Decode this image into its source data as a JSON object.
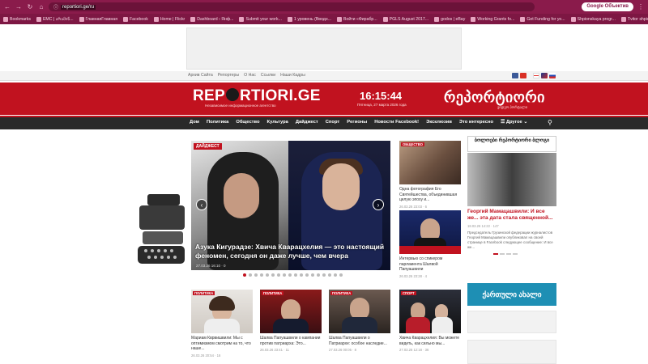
{
  "browser": {
    "url": "reportiori.ge/ru",
    "google_button": "Google Объектив",
    "bookmarks": [
      "Bookmarks",
      "EMC | არამიწ...",
      "ГлавнаяГлавная",
      "Facebook",
      "",
      "Home | Flickr",
      "Dashboard ‹ Янф...",
      "Submit your work...",
      "1 уровень (Вводн...",
      "Войти «Фирабр...",
      "PGLS August 2017...",
      "godos | eBay",
      "Working Grants fo...",
      "Get Funding for yo...",
      "Shpionskaya progr...",
      "Tvitor shpion"
    ]
  },
  "util": {
    "links": [
      "Архив Сайта",
      "Репортеры",
      "О Нас",
      "Ссылки",
      "Наши Кадры"
    ]
  },
  "header": {
    "logo_left": "REP",
    "logo_right": "RTIORI.GE",
    "logo_sub": "Независимое информационное агентство",
    "time": "16:15:44",
    "date": "Пятница, 27 марта 2026 года",
    "geo_title": "რეპორტიორი",
    "geo_sub": "ვიდეო პორტალი"
  },
  "menu": [
    "Дом",
    "Политика",
    "Общество",
    "Культура",
    "Дайджест",
    "Спорт",
    "Регионы",
    "Новости Facebook!",
    "Эксклюзив",
    "Это интересно",
    "☰ Другое ⌄"
  ],
  "slider": {
    "badge": "ДАЙДЖЕСТ",
    "title": "Азука Кигурадзе: Хвича Кварацхелия — это настоящий феномен, сегодня он даже лучше, чем вчера",
    "meta": "27.03.26 16:10 · 0",
    "active_index": 0,
    "dot_count": 18
  },
  "side_cards": [
    {
      "badge": "ОБЩЕСТВО",
      "text": "Одна фотография Его Святейшества, объединившая целую эпоху и...",
      "meta": "26.03.26 23:03 · 6"
    },
    {
      "badge": "",
      "text": "Интервью со спикером парламента Шалвой Папуашвили",
      "meta": "26.03.26 23:28 · 4"
    }
  ],
  "right_col": {
    "banner": "ბოლოები რეპორტიორი ბლოგი",
    "headline": "Георгий Мамацашвили: И все же... эта дата стала священной...",
    "meta": "18.03.26 14:22 · 147",
    "text": "Председатель Грузинской федерации журналистов Георгий Мамацашвили опубликовал на своей странице в Facebook следующее сообщение: И все же...",
    "geo_banner": "ქართული ახალი"
  },
  "bottom_cards": [
    {
      "badge": "ПОЛИТИКА",
      "text": "Мариам Кврвишвили: Мы с оптимизмом смотрим на то, что наше...",
      "meta": "26.03.26 20:54 · 16"
    },
    {
      "badge": "ПОЛИТИКА",
      "text": "Шалва Папуашвили о кампании против патриарха: Это...",
      "meta": "26.03.26 23:41 · 11"
    },
    {
      "badge": "ПОЛИТИКА",
      "text": "Шалва Папуашвили о Патриархе: особое наследие...",
      "meta": "27.03.26 00:05 · 8"
    },
    {
      "badge": "СПОРТ",
      "text": "Хвича Кварацхелия: Вы можете видеть, как сильно мы...",
      "meta": "27.03.26 12:18 · 36"
    }
  ],
  "colors": {
    "brand_red": "#c1121f",
    "browser_bg": "#8a1b4b",
    "menu_dark": "#2a2a2a"
  }
}
